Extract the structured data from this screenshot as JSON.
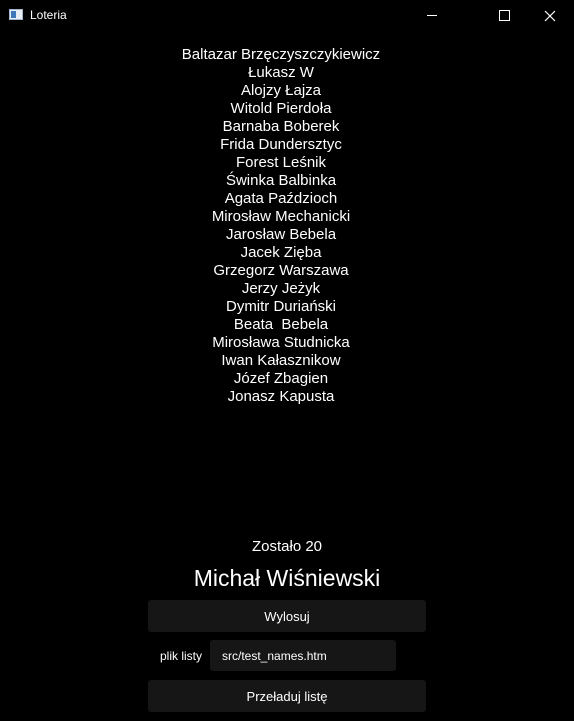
{
  "window": {
    "title": "Loteria"
  },
  "names": [
    "Baltazar Brzęczyszczykiewicz",
    "Łukasz W",
    "Alojzy Łajza",
    "Witold Pierdoła",
    "Barnaba Boberek",
    "Frida Dundersztyc",
    "Forest Leśnik",
    "Świnka Balbinka",
    "Agata Paździoch",
    "Mirosław Mechanicki",
    "Jarosław Bebela",
    "Jacek Zięba",
    "Grzegorz Warszawa",
    "Jerzy Jeżyk",
    "Dymitr Duriański",
    "Beata  Bebela",
    "Mirosława Studnicka",
    "Iwan Kałasznikow",
    "Józef Zbagien",
    "Jonasz Kapusta"
  ],
  "status": {
    "remaining": "Zostało 20",
    "winner": "Michał Wiśniewski"
  },
  "controls": {
    "draw_label": "Wylosuj",
    "file_label": "plik listy",
    "file_value": "src/test_names.htm",
    "reload_label": "Przeładuj listę"
  }
}
